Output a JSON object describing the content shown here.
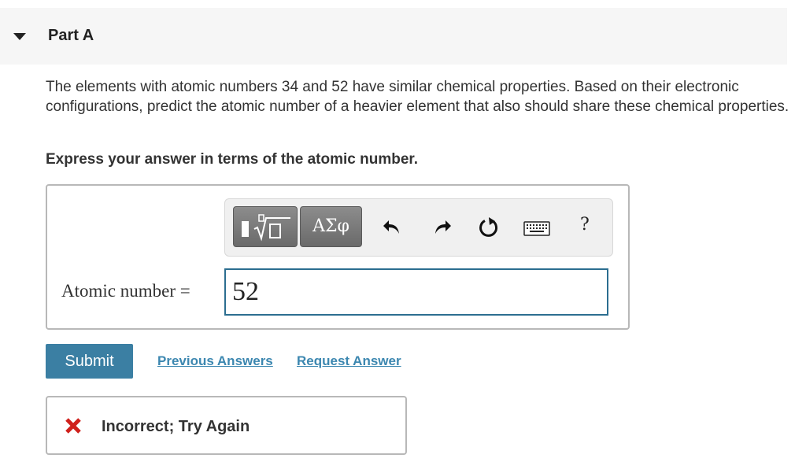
{
  "part": {
    "title": "Part A"
  },
  "question": {
    "text": "The elements with atomic numbers 34 and 52 have similar chemical properties. Based on their electronic configurations, predict the atomic number of a heavier element that also should share these chemical properties.",
    "instruction": "Express your answer in terms of the atomic number."
  },
  "toolbar": {
    "templates_icon": "templates-icon",
    "symbols_label": "ΑΣφ",
    "undo_icon": "undo-icon",
    "redo_icon": "redo-icon",
    "reset_icon": "reset-icon",
    "keyboard_icon": "keyboard-icon",
    "help_label": "?"
  },
  "answer": {
    "label": "Atomic number =",
    "value": "52"
  },
  "actions": {
    "submit_label": "Submit",
    "previous_answers_label": "Previous Answers",
    "request_answer_label": "Request Answer"
  },
  "feedback": {
    "text": "Incorrect; Try Again",
    "icon": "x-icon",
    "icon_color": "#d0211c"
  },
  "colors": {
    "submit_bg": "#3b7fa3",
    "link": "#3c87b0",
    "input_border": "#2c6e90"
  }
}
